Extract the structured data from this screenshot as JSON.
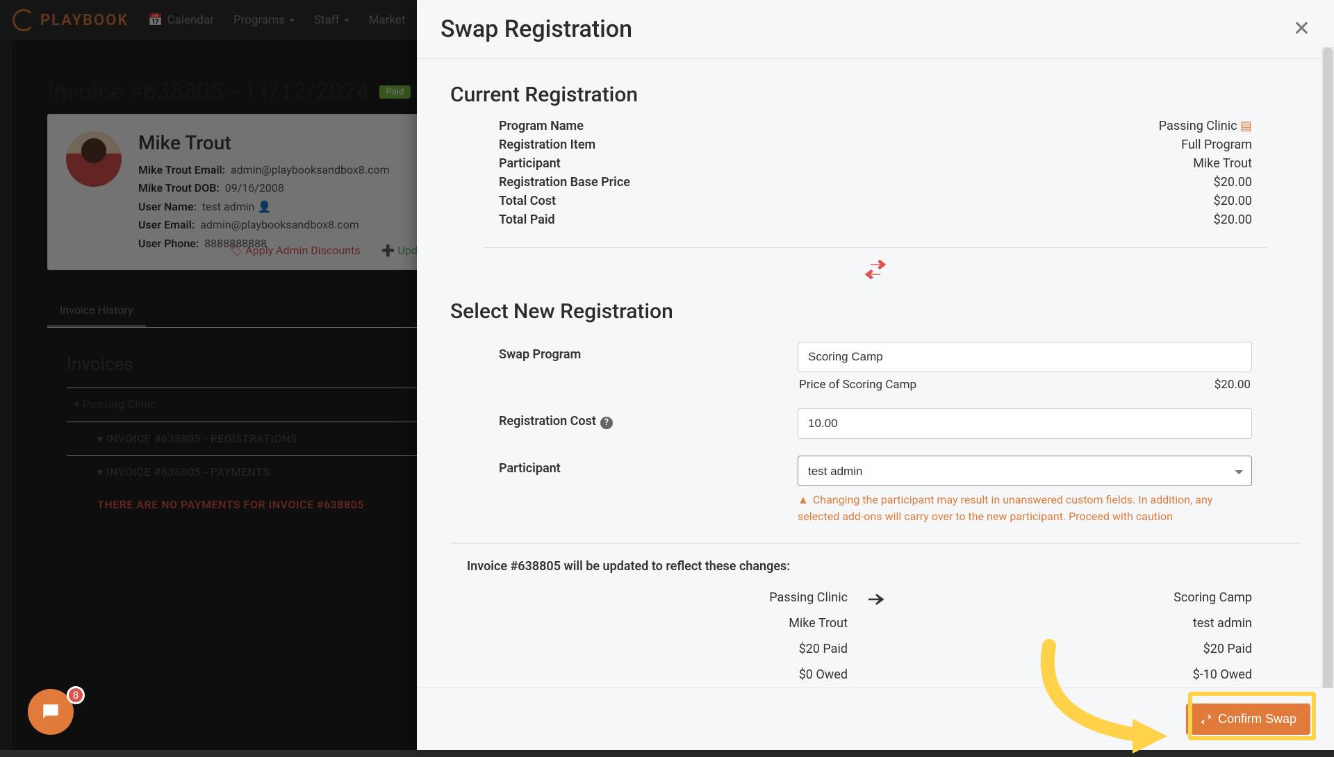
{
  "brand": "PLAYBOOK",
  "nav": {
    "calendar": "Calendar",
    "programs": "Programs",
    "staff": "Staff",
    "market": "Market"
  },
  "invoice": {
    "title": "Invoice #638805 - 11/12/2024",
    "status": "Paid",
    "contact": {
      "name": "Mike Trout",
      "email_label": "Mike Trout Email:",
      "email": "admin@playbooksandbox8.com",
      "dob_label": "Mike Trout DOB:",
      "dob": "09/16/2008",
      "user_name_label": "User Name:",
      "user_name": "test admin",
      "user_email_label": "User Email:",
      "user_email": "admin@playbooksandbox8.com",
      "user_phone_label": "User Phone:",
      "user_phone": "8888888888"
    },
    "actions": {
      "discounts": "Apply Admin Discounts",
      "update": "Update Invoice"
    },
    "tab_history": "Invoice History",
    "invoices_heading": "Invoices",
    "group": "Passing Clinic",
    "reg_section": "INVOICE #638805 - REGISTRATIONS",
    "pay_section": "INVOICE #638805 - PAYMENTS",
    "no_payments": "THERE ARE NO PAYMENTS FOR INVOICE #638805"
  },
  "modal": {
    "title": "Swap Registration",
    "current_heading": "Current Registration",
    "kv": {
      "program_name_k": "Program Name",
      "program_name_v": "Passing Clinic",
      "reg_item_k": "Registration Item",
      "reg_item_v": "Full Program",
      "participant_k": "Participant",
      "participant_v": "Mike Trout",
      "base_price_k": "Registration Base Price",
      "base_price_v": "$20.00",
      "total_cost_k": "Total Cost",
      "total_cost_v": "$20.00",
      "total_paid_k": "Total Paid",
      "total_paid_v": "$20.00"
    },
    "select_heading": "Select New Registration",
    "form": {
      "swap_label": "Swap Program",
      "swap_value": "Scoring Camp",
      "price_label": "Price of Scoring Camp",
      "price_value": "$20.00",
      "cost_label": "Registration Cost",
      "cost_value": "10.00",
      "participant_label": "Participant",
      "participant_value": "test admin",
      "warn": "Changing the participant may result in unanswered custom fields. In addition, any selected add-ons will carry over to the new participant. Proceed with caution"
    },
    "changes_heading": "Invoice #638805 will be updated to reflect these changes:",
    "changes": {
      "left": {
        "program": "Passing Clinic",
        "participant": "Mike Trout",
        "paid": "$20 Paid",
        "owed": "$0 Owed"
      },
      "right": {
        "program": "Scoring Camp",
        "participant": "test admin",
        "paid": "$20 Paid",
        "owed": "$-10 Owed"
      }
    },
    "confirm": "Confirm Swap"
  },
  "chat_count": "8"
}
